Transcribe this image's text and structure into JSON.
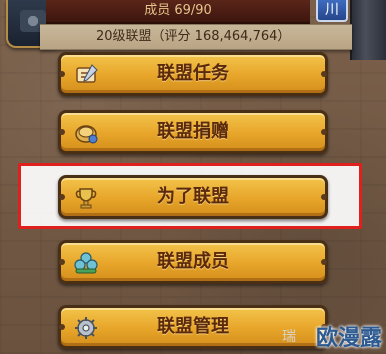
{
  "header": {
    "members_label": "成员 69/90",
    "close_glyph": "川",
    "score_line": "20级联盟（评分 168,464,764）"
  },
  "menu": [
    {
      "label": "联盟任务",
      "icon": "quest-scroll-icon"
    },
    {
      "label": "联盟捐赠",
      "icon": "coin-donation-icon"
    },
    {
      "label": "为了联盟",
      "icon": "trophy-icon"
    },
    {
      "label": "联盟成员",
      "icon": "members-group-icon"
    },
    {
      "label": "联盟管理",
      "icon": "gear-icon"
    }
  ],
  "watermark": {
    "small": "瑞",
    "main": "欧漫露"
  },
  "colors": {
    "button_gold": "#e7a52a",
    "button_text": "#5b2a0c",
    "highlight_red": "#e0201c"
  }
}
